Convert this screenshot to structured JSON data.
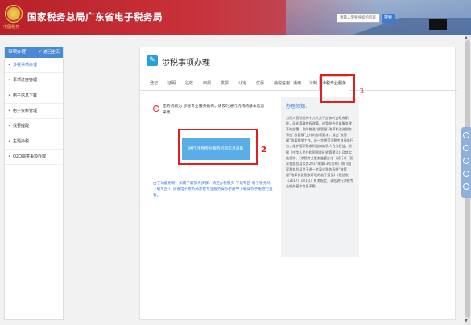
{
  "header": {
    "site_title": "国家税务总局广东省电子税务局",
    "logo_subtext": "中国税务",
    "search_placeholder": "请输入需要搜索的内容",
    "search_label": "搜索"
  },
  "sidebar": {
    "title": "事项办理",
    "back_label": "返回主页",
    "items": [
      {
        "label": "涉税事项办理",
        "active": true
      },
      {
        "label": "事项进度管理"
      },
      {
        "label": "电子信息下载"
      },
      {
        "label": "电子资料管理"
      },
      {
        "label": "我要提醒"
      },
      {
        "label": "主题办税"
      },
      {
        "label": "O2O邮寄事项办理"
      }
    ]
  },
  "main": {
    "page_title": "涉税事项办理",
    "tabs": [
      "登记",
      "证明",
      "征收",
      "申报",
      "发票",
      "认定",
      "优惠",
      "纳税信用",
      "通用",
      "法制"
    ],
    "active_tab": "涉税专业服务",
    "notice": "您的机构为 涉税专业服务机构，请及时进行机构的基本信息采集。",
    "collect_button": "进行 涉税专业服务机构信息采集",
    "help_text": "由于功能更新，如需了解操作步骤，请至办税服务-下载专区-电子税务局下载专区-广东省电子税务局涉税专业服务操作手册中下载操作手册进行查看。",
    "info": {
      "title": "办理须知：",
      "body": "为深入贯彻党的十九大关于加快转变政府职能，深化简政放权改革，放管结合优化服务改革的部署，及时推进“放管服”改革和改进税务系统“放管服”工作的各项要求，推出“放管服”改革相关工作，进一步规范涉税专业服务行为，维护国家税收利益和纳税人合法权益，根据《中华人民共和国税收征收管理法》及其实施细则、《涉税专业服务监管办法（试行）》（国家税务总局公告2017年第13号发布）和《国家税务总局关于进一步深化税务系统“放管服”改革优化税收环境的若干意见》（税总发〔2017〕101号）有关规定，请您进行涉税专业服务基本信息采集。"
    }
  },
  "annotations": {
    "marker_1": "1",
    "marker_2": "2"
  },
  "colors": {
    "accent": "#3a7bd5",
    "header_red": "#b8202a",
    "annotation": "#e02020"
  }
}
